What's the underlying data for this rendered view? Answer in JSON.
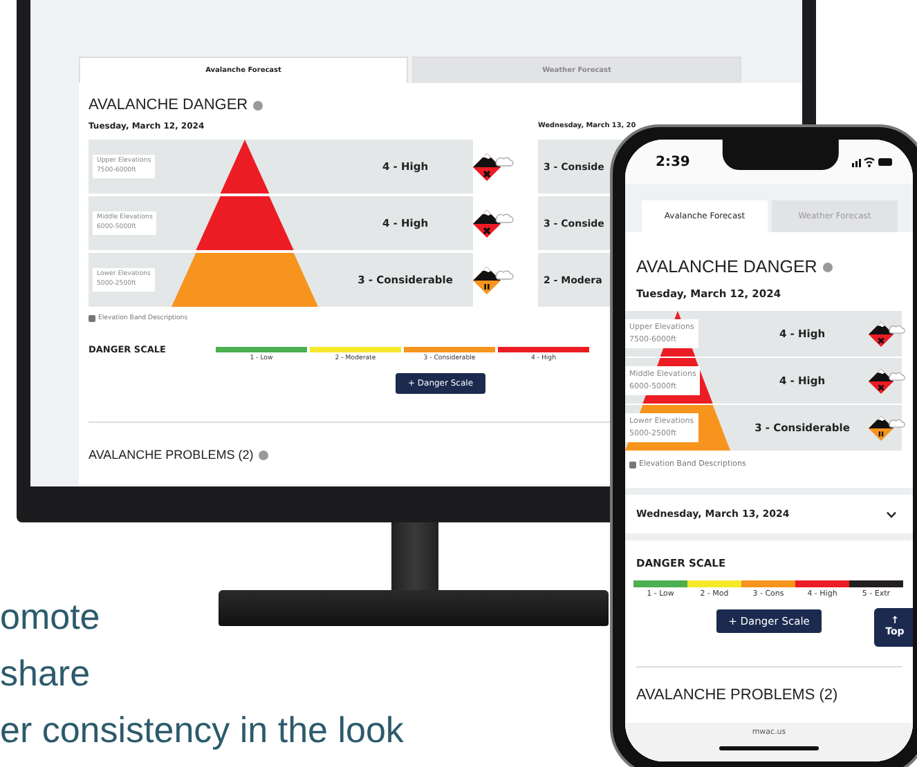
{
  "monitor": {
    "tabs": [
      {
        "label": "Avalanche Forecast",
        "selected": true
      },
      {
        "label": "Weather Forecast",
        "selected": false
      }
    ],
    "title": "AVALANCHE DANGER",
    "today": {
      "date": "Tuesday, March 12, 2024",
      "bands": [
        {
          "name": "Upper Elevations",
          "range": "7500-6000ft",
          "rating": "4 - High",
          "color": "#ec1c24",
          "kind": "high"
        },
        {
          "name": "Middle Elevations",
          "range": "6000-5000ft",
          "rating": "4 - High",
          "color": "#ec1c24",
          "kind": "high"
        },
        {
          "name": "Lower Elevations",
          "range": "5000-2500ft",
          "rating": "3 - Considerable",
          "color": "#f7941d",
          "kind": "considerable"
        }
      ]
    },
    "tomorrow": {
      "date": "Wednesday, March 13, 20",
      "ratings": [
        "3 - Conside",
        "3 - Conside",
        "2 - Modera"
      ]
    },
    "band_note": "Elevation Band Descriptions",
    "scale": {
      "title": "DANGER SCALE",
      "levels": [
        {
          "label": "1 - Low",
          "color": "#4caf50"
        },
        {
          "label": "2 - Moderate",
          "color": "#f5e92b"
        },
        {
          "label": "3 - Considerable",
          "color": "#f7941d"
        },
        {
          "label": "4 - High",
          "color": "#ec1c24"
        }
      ]
    },
    "scale_button": "+ Danger Scale",
    "problems_title": "AVALANCHE PROBLEMS (2)"
  },
  "phone": {
    "time": "2:39",
    "tabs": [
      {
        "label": "Avalanche Forecast",
        "selected": true
      },
      {
        "label": "Weather Forecast",
        "selected": false
      }
    ],
    "title": "AVALANCHE DANGER",
    "date": "Tuesday, March 12, 2024",
    "bands": [
      {
        "name": "Upper Elevations",
        "range": "7500-6000ft",
        "rating": "4 - High",
        "color": "#ec1c24",
        "kind": "high"
      },
      {
        "name": "Middle Elevations",
        "range": "6000-5000ft",
        "rating": "4 - High",
        "color": "#ec1c24",
        "kind": "high"
      },
      {
        "name": "Lower Elevations",
        "range": "5000-2500ft",
        "rating": "3 - Considerable",
        "color": "#f7941d",
        "kind": "considerable"
      }
    ],
    "band_note": "Elevation Band Descriptions",
    "next_day": {
      "date": "Wednesday, March 13, 2024",
      "expanded": false
    },
    "scale": {
      "title": "DANGER SCALE",
      "levels": [
        {
          "label": "1 - Low",
          "color": "#4caf50"
        },
        {
          "label": "2 - Mod",
          "color": "#f5e92b"
        },
        {
          "label": "3 - Cons",
          "color": "#f7941d"
        },
        {
          "label": "4 - High",
          "color": "#ec1c24"
        },
        {
          "label": "5 - Extr",
          "color": "#231f20"
        }
      ]
    },
    "scale_button": "+ Danger Scale",
    "top_button": {
      "arrow": "↑",
      "label": "Top"
    },
    "problems_title": "AVALANCHE PROBLEMS (2)",
    "url": "mwac.us"
  },
  "tagline": [
    "omote",
    "share",
    "er consistency in the look"
  ]
}
